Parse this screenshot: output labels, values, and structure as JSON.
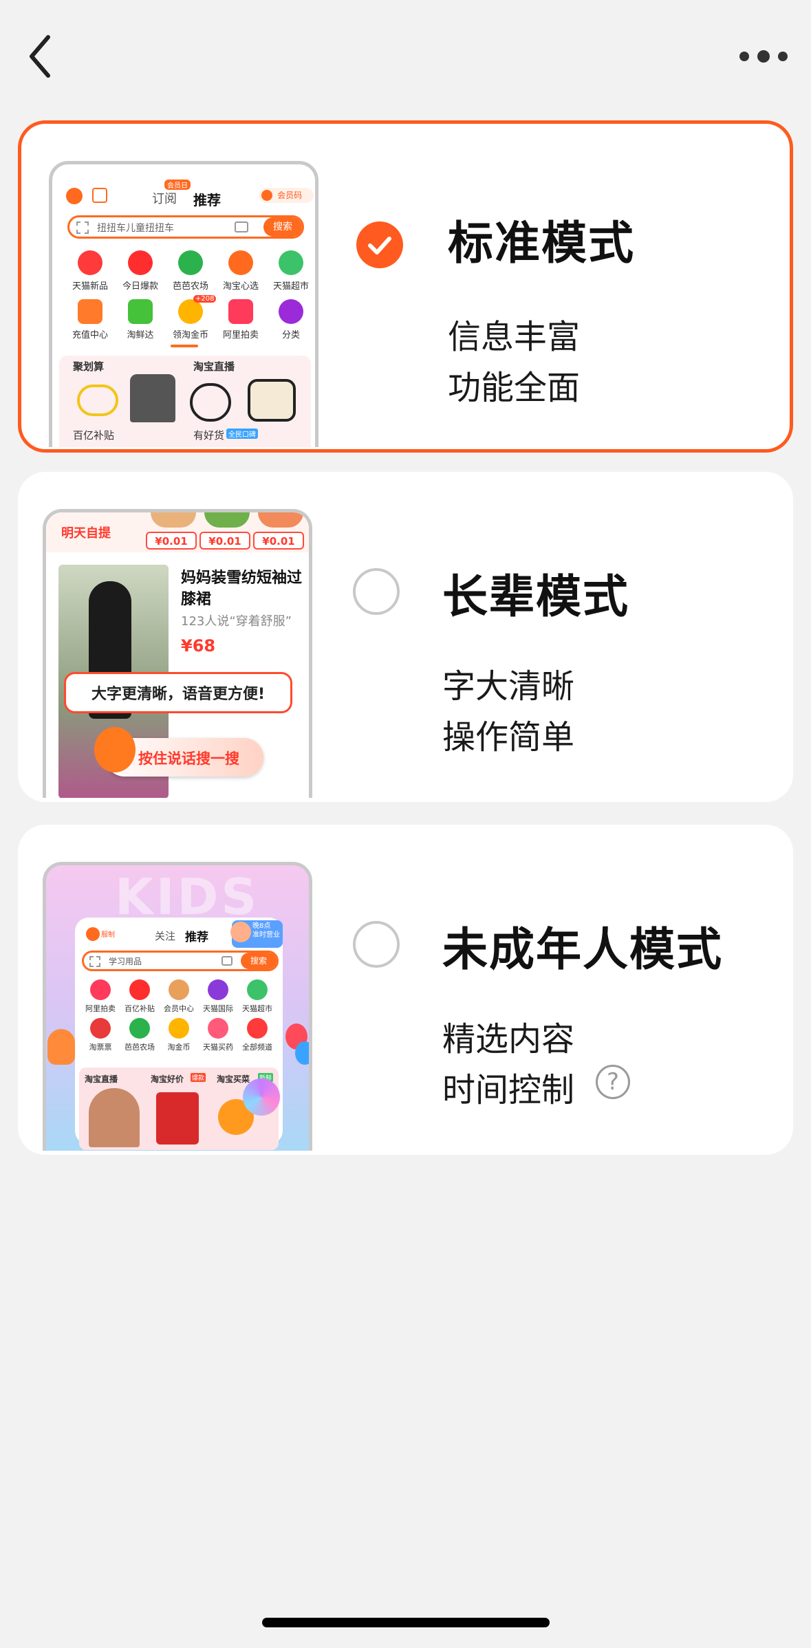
{
  "nav": {
    "back_icon": "chevron-left-icon",
    "more_icon": "more-dots-icon"
  },
  "accent_color": "#ff5a1f",
  "modes": [
    {
      "title": "标准模式",
      "line1": "信息丰富",
      "line2": "功能全面",
      "selected": true,
      "thumb": {
        "tab_subscribe": "订阅",
        "badge": "会员日",
        "tab_recommend": "推荐",
        "member_code": "会员码",
        "search_placeholder": "扭扭车儿童扭扭车",
        "search_button": "搜索",
        "icons": [
          "天猫新品",
          "今日爆款",
          "芭芭农场",
          "淘宝心选",
          "天猫超市",
          "充值中心",
          "淘鲜达",
          "领淘金币",
          "阿里拍卖",
          "分类"
        ],
        "coin_badge": "+208",
        "sec1": "聚划算",
        "sec2": "淘宝直播",
        "sec3": "百亿补贴",
        "sec4": "有好货",
        "sec4_tag": "全民口碑"
      }
    },
    {
      "title": "长辈模式",
      "line1": "字大清晰",
      "line2": "操作简单",
      "selected": false,
      "thumb": {
        "pickup": "明天自提",
        "prices": [
          "¥0.01",
          "¥0.01",
          "¥0.01"
        ],
        "product_name": "妈妈装雪纺短袖过膝裙",
        "review": "123人说“穿着舒服”",
        "price": "¥68",
        "bubble": "大字更清晰，语音更方便!",
        "voice_button": "按住说话搜一搜"
      }
    },
    {
      "title": "未成年人模式",
      "line1": "精选内容",
      "line2": "时间控制",
      "selected": false,
      "help_icon": "?",
      "thumb": {
        "bg_text": "KIDS",
        "tab_follow": "关注",
        "tab_recommend": "推荐",
        "search_placeholder": "学习用品",
        "search_button": "搜索",
        "corner_line1": "晚8点",
        "corner_line2": "准时营业",
        "logo_tag": "服制",
        "icons": [
          "阿里拍卖",
          "百亿补贴",
          "会员中心",
          "天猫国际",
          "天猫超市",
          "淘票票",
          "芭芭农场",
          "淘金币",
          "天猫买药",
          "全部频道"
        ],
        "sec1": "淘宝直播",
        "sec2": "淘宝好价",
        "sec2_tag": "爆款",
        "sec3": "淘宝买菜",
        "sec3_tag": "新鲜"
      }
    }
  ]
}
